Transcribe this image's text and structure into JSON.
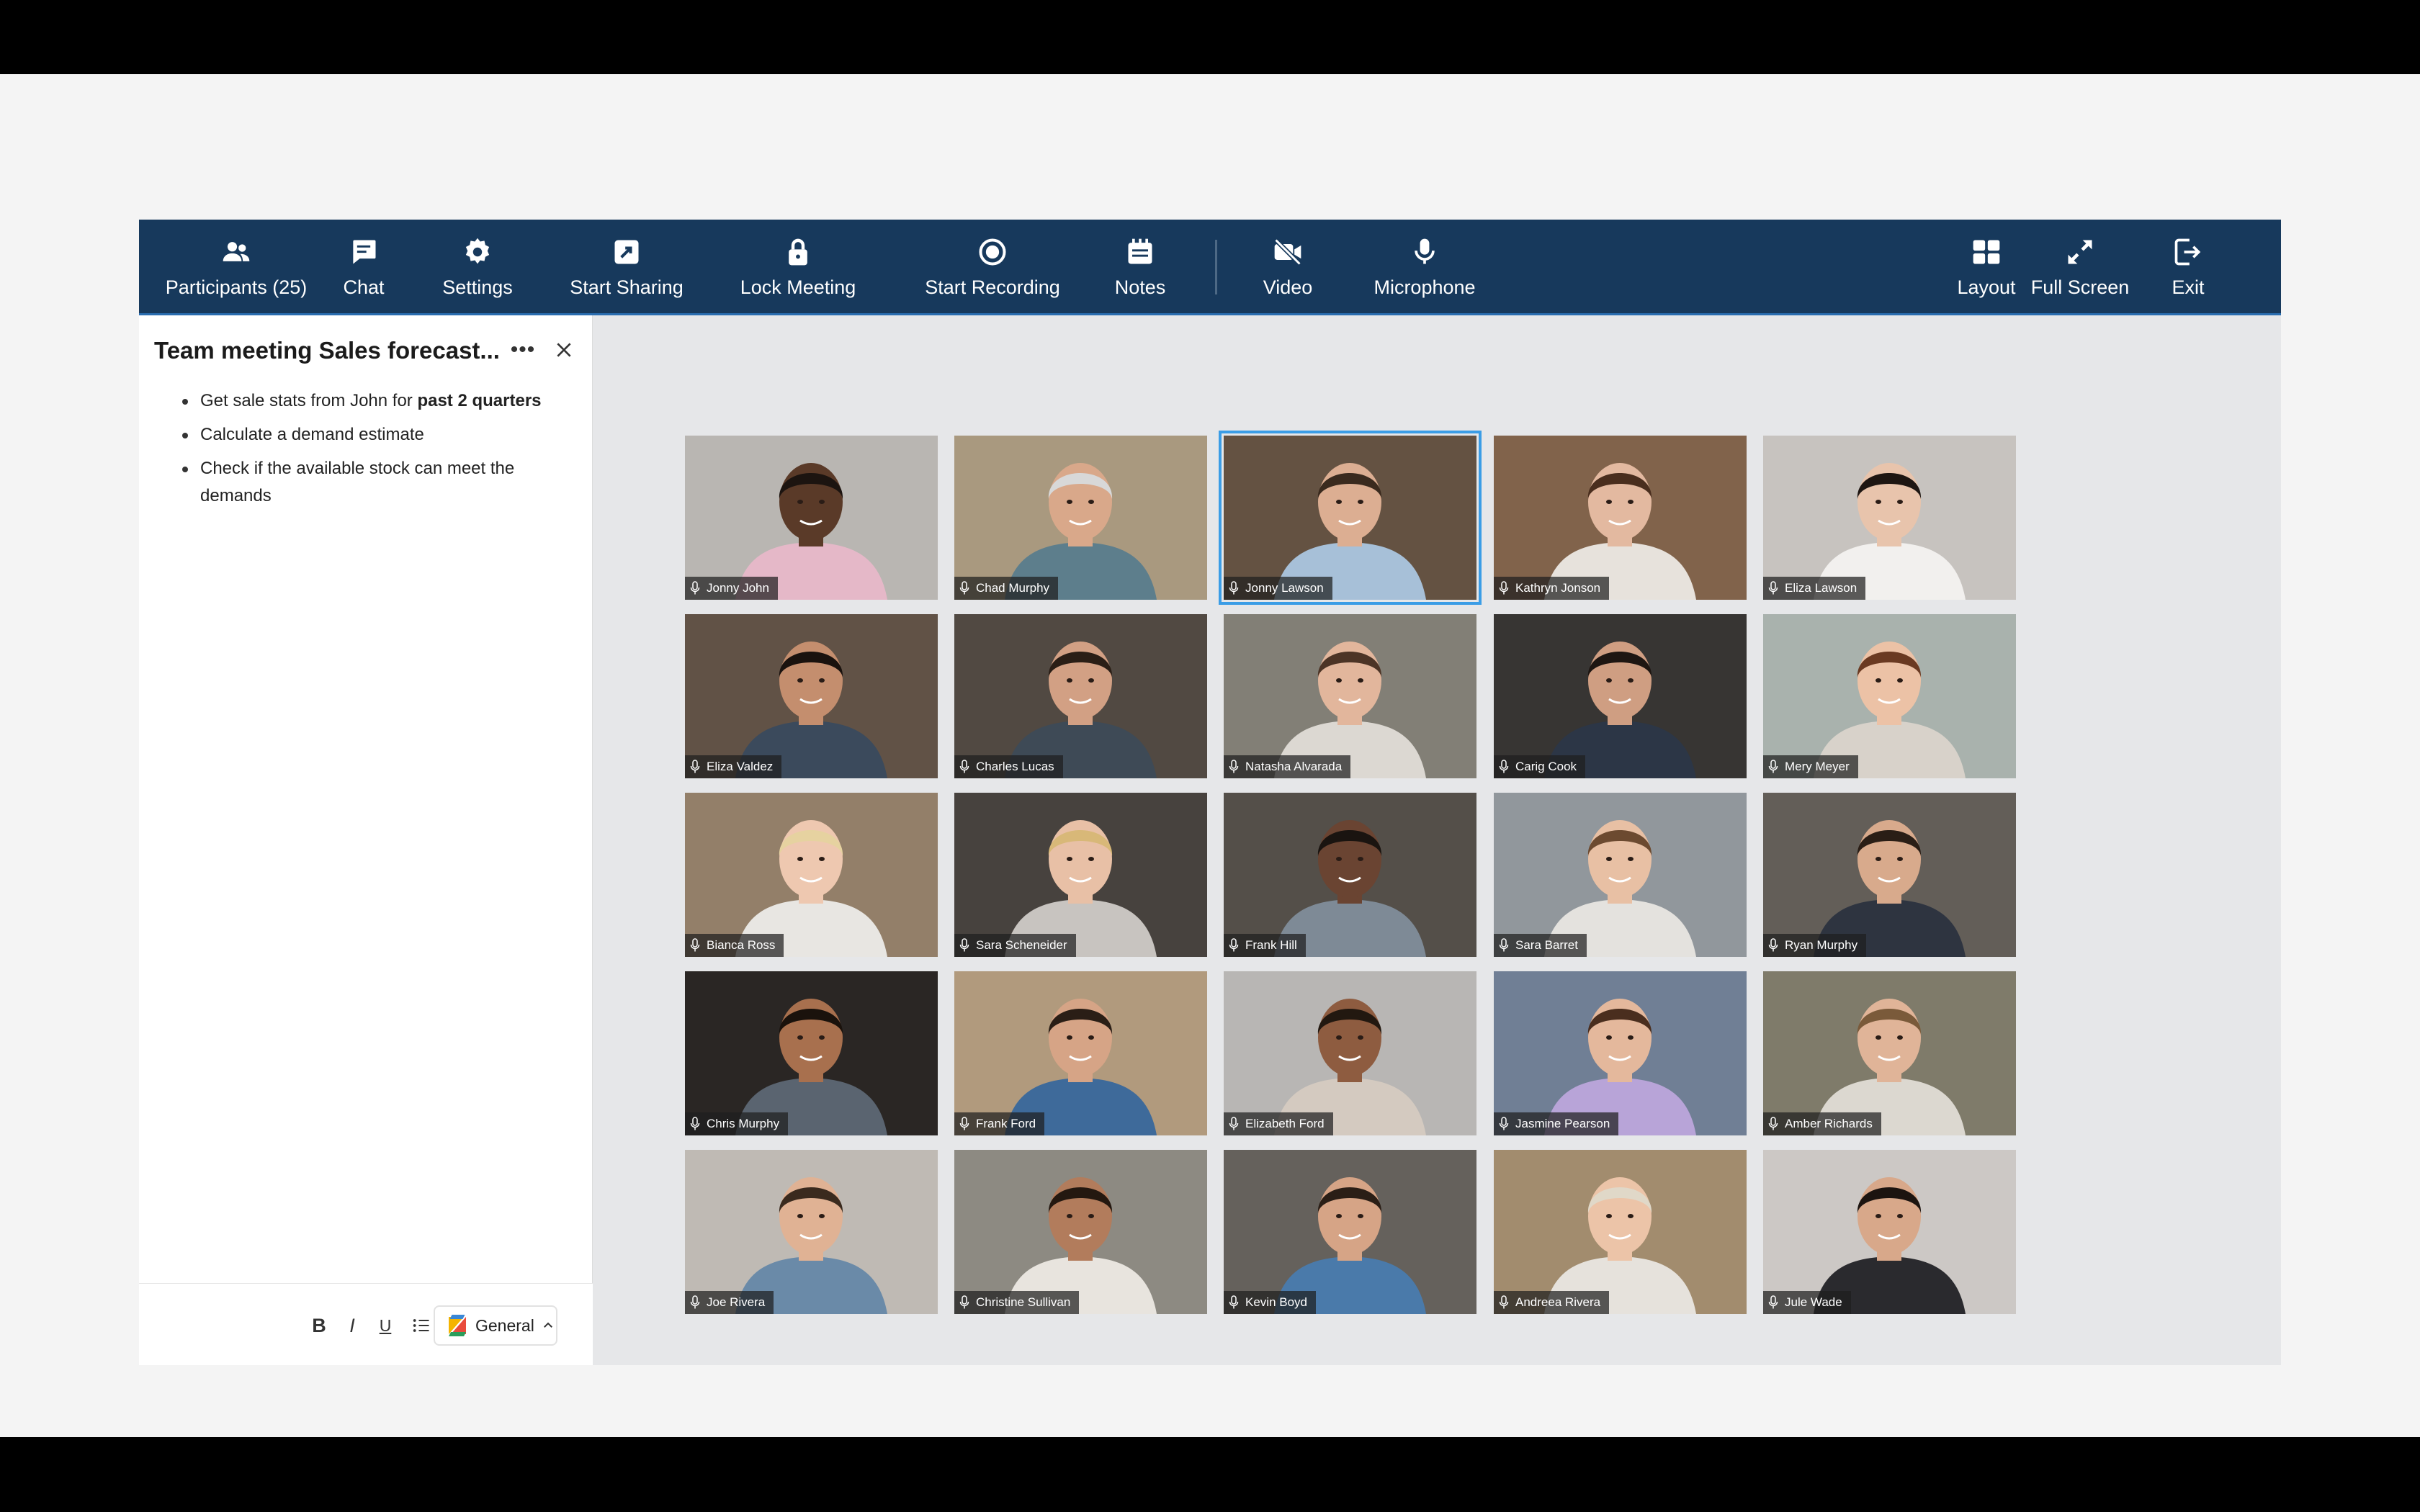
{
  "toolbar": {
    "participants_label": "Participants (25)",
    "chat_label": "Chat",
    "settings_label": "Settings",
    "sharing_label": "Start Sharing",
    "lock_label": "Lock Meeting",
    "recording_label": "Start Recording",
    "notes_label": "Notes",
    "video_label": "Video",
    "microphone_label": "Microphone",
    "layout_label": "Layout",
    "fullscreen_label": "Full Screen",
    "exit_label": "Exit"
  },
  "notes": {
    "title": "Team meeting Sales forecast...",
    "items": [
      {
        "text": "Get sale stats from John for ",
        "bold": "past 2 quarters"
      },
      {
        "text": "Calculate a demand estimate",
        "bold": ""
      },
      {
        "text": "Check if the available stock can meet the demands",
        "bold": ""
      }
    ],
    "format": {
      "bold": "B",
      "italic": "I",
      "underline": "U"
    },
    "notebook": "General"
  },
  "participants": [
    {
      "name": "Jonny John",
      "bg": "#c9c6c2",
      "skin": "#5a3a28",
      "hair": "#1c1410",
      "shirt": "#e5b8c8"
    },
    {
      "name": "Chad Murphy",
      "bg": "#b8a68a",
      "skin": "#d9a88a",
      "hair": "#d8d8d8",
      "shirt": "#5d7e8c"
    },
    {
      "name": "Jonny Lawson",
      "bg": "#6d5a48",
      "skin": "#dcae92",
      "hair": "#3a2a1e",
      "shirt": "#a7c0d8"
    },
    {
      "name": "Kathryn Jonson",
      "bg": "#8c6c52",
      "skin": "#e3b9a0",
      "hair": "#4a2e1e",
      "shirt": "#e7e2dc"
    },
    {
      "name": "Eliza Lawson",
      "bg": "#d8d4d0",
      "skin": "#e8c4ac",
      "hair": "#1e1612",
      "shirt": "#f2f0ee"
    },
    {
      "name": "Eliza Valdez",
      "bg": "#6a5a4c",
      "skin": "#c48e6e",
      "hair": "#1a120e",
      "shirt": "#3b4a5c"
    },
    {
      "name": "Charles Lucas",
      "bg": "#585048",
      "skin": "#d2a084",
      "hair": "#2a1e16",
      "shirt": "#3e4a56"
    },
    {
      "name": "Natasha Alvarada",
      "bg": "#8e8a80",
      "skin": "#e2b69c",
      "hair": "#4c3426",
      "shirt": "#dcd8d2"
    },
    {
      "name": "Carig Cook",
      "bg": "#3c3a38",
      "skin": "#cf9e82",
      "hair": "#1e1612",
      "shirt": "#2c3646"
    },
    {
      "name": "Mery Meyer",
      "bg": "#b8c2bc",
      "skin": "#ecc2a6",
      "hair": "#6a3a22",
      "shirt": "#d8d2ca"
    },
    {
      "name": "Bianca Ross",
      "bg": "#a08a72",
      "skin": "#eec8b0",
      "hair": "#e6d2a0",
      "shirt": "#e8e6e2"
    },
    {
      "name": "Sara Scheneider",
      "bg": "#4e4844",
      "skin": "#e8c0a6",
      "hair": "#d8b878",
      "shirt": "#c8c4c0"
    },
    {
      "name": "Frank Hill",
      "bg": "#5c5650",
      "skin": "#6a4432",
      "hair": "#1a1410",
      "shirt": "#7e8a96"
    },
    {
      "name": "Sara Barret",
      "bg": "#9ea4aa",
      "skin": "#e8c0a4",
      "hair": "#6c4a30",
      "shirt": "#e4e2de"
    },
    {
      "name": "Ryan Murphy",
      "bg": "#6c6660",
      "skin": "#d8aa8c",
      "hair": "#2a1e16",
      "shirt": "#2e3440"
    },
    {
      "name": "Chris Murphy",
      "bg": "#2e2a28",
      "skin": "#a8704e",
      "hair": "#1a120c",
      "shirt": "#5a6470"
    },
    {
      "name": "Frank Ford",
      "bg": "#c0a888",
      "skin": "#d6a486",
      "hair": "#2a1e16",
      "shirt": "#3e6a9a"
    },
    {
      "name": "Elizabeth Ford",
      "bg": "#c8c6c4",
      "skin": "#8e5c40",
      "hair": "#221810",
      "shirt": "#d4cac0"
    },
    {
      "name": "Jasmine Pearson",
      "bg": "#7a8aa2",
      "skin": "#e4b89c",
      "hair": "#4a2e1e",
      "shirt": "#b8a4d8"
    },
    {
      "name": "Amber Richards",
      "bg": "#8a8674",
      "skin": "#e0b498",
      "hair": "#7a5a3a",
      "shirt": "#dcd8d0"
    },
    {
      "name": "Joe Rivera",
      "bg": "#d0cac4",
      "skin": "#e0b294",
      "hair": "#3a2a1e",
      "shirt": "#6a8aa8"
    },
    {
      "name": "Christine Sullivan",
      "bg": "#9a968e",
      "skin": "#b27c5c",
      "hair": "#241810",
      "shirt": "#e8e4de"
    },
    {
      "name": "Kevin Boyd",
      "bg": "#6e6a64",
      "skin": "#d6a486",
      "hair": "#2a1e16",
      "shirt": "#4a7aaa"
    },
    {
      "name": "Andreea Rivera",
      "bg": "#b09878",
      "skin": "#ecc4a8",
      "hair": "#e0d8c8",
      "shirt": "#e6e2dc"
    },
    {
      "name": "Jule Wade",
      "bg": "#dedad6",
      "skin": "#d8a88a",
      "hair": "#1c1410",
      "shirt": "#2a2a2e"
    }
  ],
  "active_speaker": "Jonny Lawson"
}
